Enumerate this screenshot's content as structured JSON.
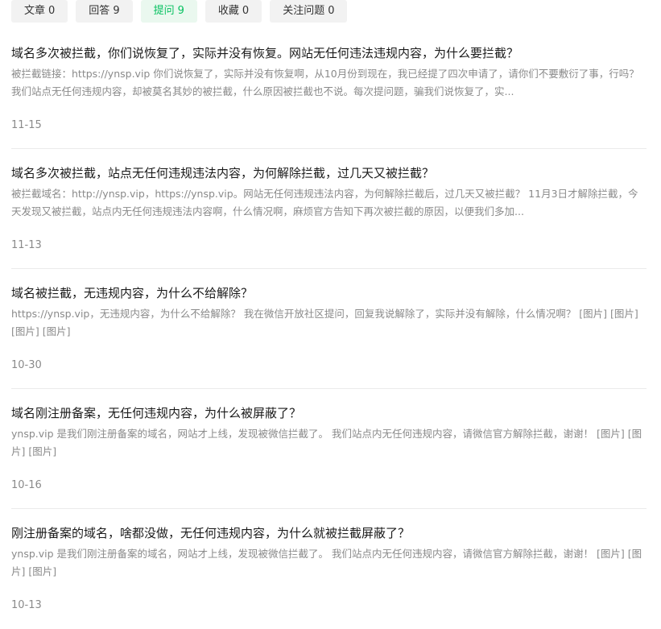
{
  "tabs": [
    {
      "label": "文章",
      "count": "0",
      "active": false
    },
    {
      "label": "回答",
      "count": "9",
      "active": false
    },
    {
      "label": "提问",
      "count": "9",
      "active": true
    },
    {
      "label": "收藏",
      "count": "0",
      "active": false
    },
    {
      "label": "关注问题",
      "count": "0",
      "active": false
    }
  ],
  "accent_color": "#07c160",
  "questions": [
    {
      "title": "域名多次被拦截，你们说恢复了，实际并没有恢复。网站无任何违法违规内容，为什么要拦截？",
      "summary": "被拦截链接：https://ynsp.vip 你们说恢复了，实际并没有恢复啊，从10月份到现在，我已经提了四次申请了，请你们不要敷衍了事，行吗？ 我们站点无任何违规内容，却被莫名其妙的被拦截，什么原因被拦截也不说。每次提问题，骗我们说恢复了，实...",
      "date": "11-15"
    },
    {
      "title": "域名多次被拦截，站点无任何违规违法内容，为何解除拦截，过几天又被拦截？",
      "summary": "被拦截域名：http://ynsp.vip，https://ynsp.vip。网站无任何违规违法内容，为何解除拦截后，过几天又被拦截？ 11月3日才解除拦截，今天发现又被拦截，站点内无任何违规违法内容啊，什么情况啊，麻烦官方告知下再次被拦截的原因，以便我们多加...",
      "date": "11-13"
    },
    {
      "title": "域名被拦截，无违规内容，为什么不给解除？",
      "summary": "https://ynsp.vip，无违规内容，为什么不给解除？ 我在微信开放社区提问，回复我说解除了，实际并没有解除，什么情况啊？ [图片] [图片] [图片] [图片]",
      "date": "10-30"
    },
    {
      "title": "域名刚注册备案，无任何违规内容，为什么被屏蔽了？",
      "summary": "ynsp.vip 是我们刚注册备案的域名，网站才上线，发现被微信拦截了。 我们站点内无任何违规内容，请微信官方解除拦截，谢谢！ [图片] [图片] [图片]",
      "date": "10-16"
    },
    {
      "title": "刚注册备案的域名，啥都没做，无任何违规内容，为什么就被拦截屏蔽了？",
      "summary": "ynsp.vip 是我们刚注册备案的域名，网站才上线，发现被微信拦截了。 我们站点内无任何违规内容，请微信官方解除拦截，谢谢！ [图片] [图片] [图片]",
      "date": "10-13"
    }
  ]
}
